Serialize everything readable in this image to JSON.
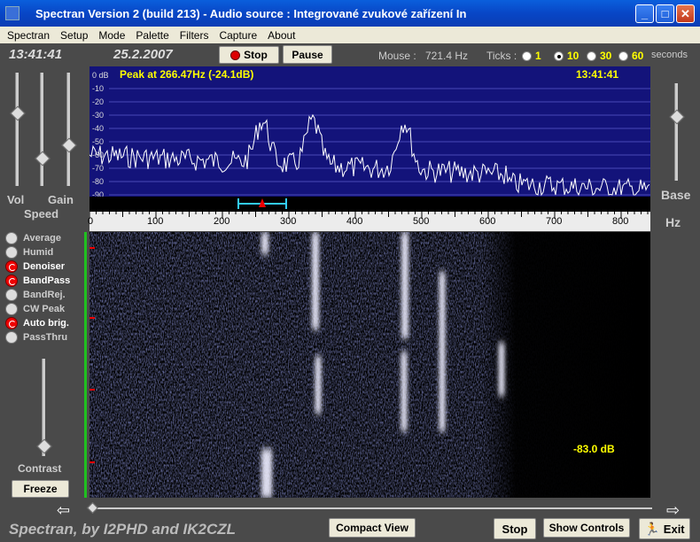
{
  "window": {
    "title": "Spectran Version 2  (build 213) - Audio source  :  Integrované zvukové zařízení In",
    "controls": {
      "minimize": "_",
      "maximize": "□",
      "close": "✕"
    }
  },
  "menu": [
    "Spectran",
    "Setup",
    "Mode",
    "Palette",
    "Filters",
    "Capture",
    "About"
  ],
  "status": {
    "clock": "13:41:41",
    "date": "25.2.2007",
    "stop_label": "Stop",
    "pause_label": "Pause",
    "mouse_label": "Mouse :",
    "mouse_value": "721.4 Hz",
    "ticks_label": "Ticks :",
    "ticks": [
      "1",
      "10",
      "30",
      "60"
    ],
    "ticks_selected": "10",
    "seconds_label": "seconds"
  },
  "left_panel": {
    "vol_label": "Vol",
    "gain_label": "Gain",
    "speed_label": "Speed",
    "options": [
      {
        "label": "Average",
        "active": false
      },
      {
        "label": "Humid",
        "active": false
      },
      {
        "label": "Denoiser",
        "active": true
      },
      {
        "label": "BandPass",
        "active": true
      },
      {
        "label": "BandRej.",
        "active": false
      },
      {
        "label": "CW Peak",
        "active": false
      },
      {
        "label": "Auto brig.",
        "active": true
      },
      {
        "label": "PassThru",
        "active": false
      }
    ],
    "contrast_label": "Contrast",
    "freeze_label": "Freeze"
  },
  "right_panel": {
    "base_label": "Base",
    "hz_label": "Hz"
  },
  "spectrum": {
    "peak_text": "Peak at   266.47Hz (-24.1dB)",
    "time": "13:41:41",
    "db_labels": [
      "0 dB",
      "-10",
      "-20",
      "-30",
      "-40",
      "-50",
      "-60",
      "-70",
      "-80",
      "-90"
    ]
  },
  "axis": {
    "ticks": [
      "0",
      "100",
      "200",
      "300",
      "400",
      "500",
      "600",
      "700",
      "800"
    ]
  },
  "waterfall": {
    "db_readout": "-83.0 dB"
  },
  "bottom": {
    "brand": "Spectran, by I2PHD and IK2CZL",
    "compact_label": "Compact View",
    "stop_label": "Stop",
    "show_controls_label": "Show Controls",
    "exit_label": "Exit"
  },
  "colors": {
    "background": "#4a4a4a",
    "spectrum_bg": "#13137a",
    "accent": "#ffff00"
  }
}
